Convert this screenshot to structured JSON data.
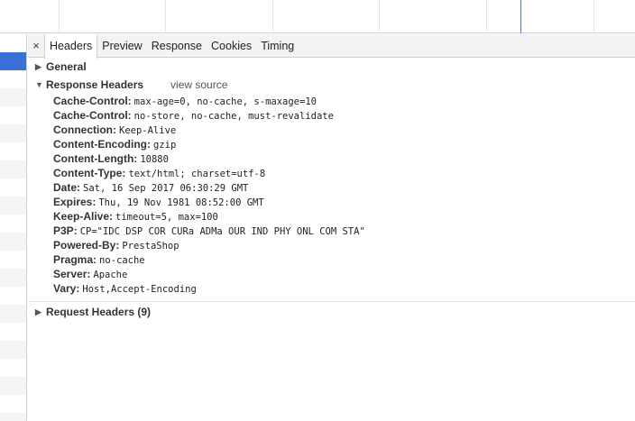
{
  "tabs": {
    "close_label": "×",
    "items": [
      "Headers",
      "Preview",
      "Response",
      "Cookies",
      "Timing"
    ]
  },
  "general": {
    "title": "General"
  },
  "response_headers": {
    "title": "Response Headers",
    "view_source": "view source",
    "rows": [
      {
        "name": "Cache-Control:",
        "value": "max-age=0, no-cache, s-maxage=10"
      },
      {
        "name": "Cache-Control:",
        "value": "no-store, no-cache, must-revalidate"
      },
      {
        "name": "Connection:",
        "value": "Keep-Alive"
      },
      {
        "name": "Content-Encoding:",
        "value": "gzip"
      },
      {
        "name": "Content-Length:",
        "value": "10880"
      },
      {
        "name": "Content-Type:",
        "value": "text/html; charset=utf-8"
      },
      {
        "name": "Date:",
        "value": "Sat, 16 Sep 2017 06:30:29 GMT"
      },
      {
        "name": "Expires:",
        "value": "Thu, 19 Nov 1981 08:52:00 GMT"
      },
      {
        "name": "Keep-Alive:",
        "value": "timeout=5, max=100"
      },
      {
        "name": "P3P:",
        "value": "CP=\"IDC DSP COR CURa ADMa OUR IND PHY ONL COM STA\""
      },
      {
        "name": "Powered-By:",
        "value": "PrestaShop"
      },
      {
        "name": "Pragma:",
        "value": "no-cache"
      },
      {
        "name": "Server:",
        "value": "Apache"
      },
      {
        "name": "Vary:",
        "value": "Host,Accept-Encoding"
      }
    ]
  },
  "request_headers": {
    "title": "Request Headers (9)"
  },
  "icons": {
    "expanded": "triangle-down-icon",
    "collapsed": "triangle-right-icon"
  }
}
